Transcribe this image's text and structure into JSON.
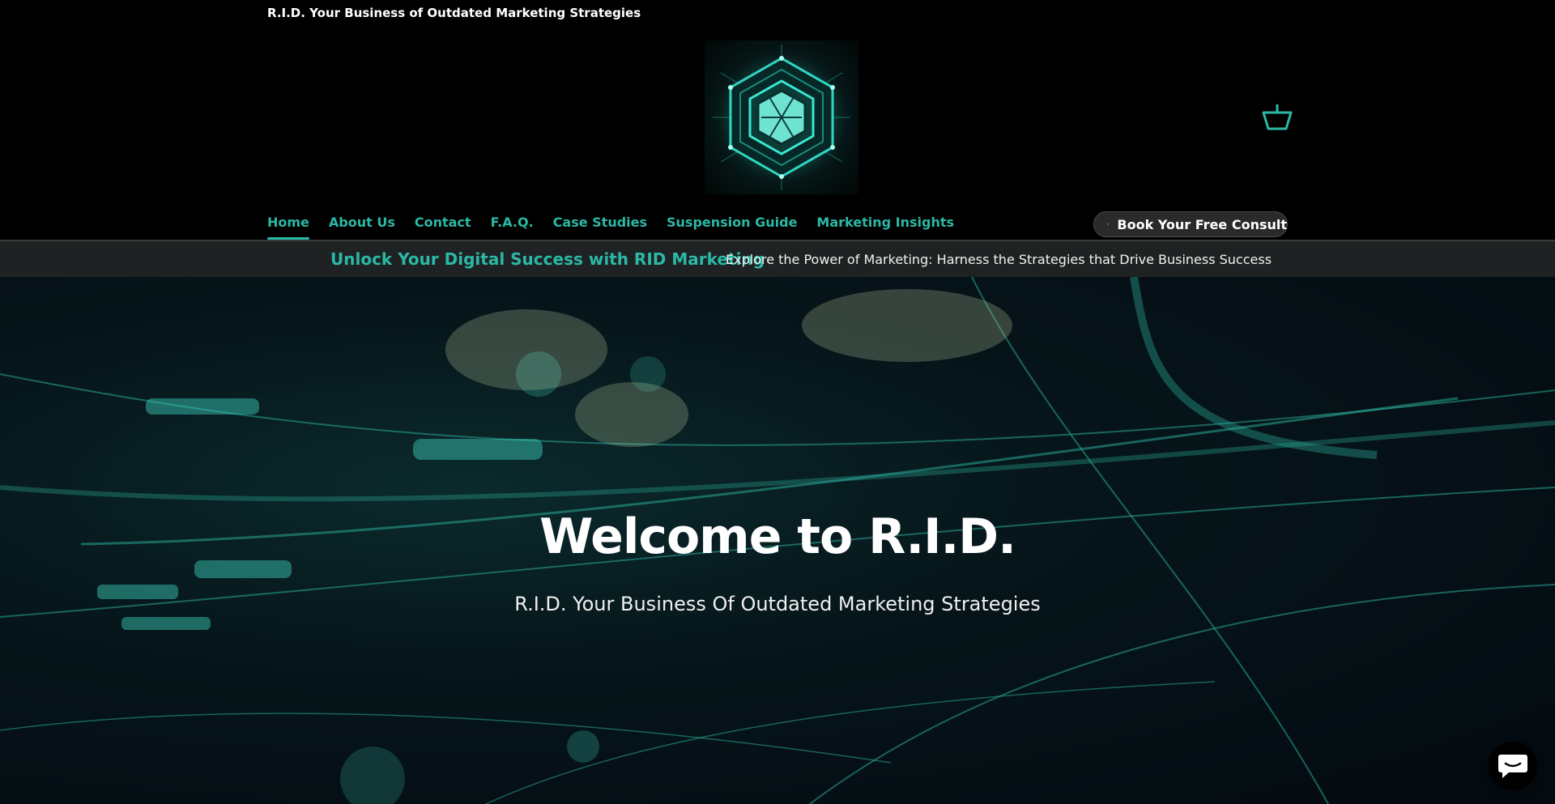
{
  "site": {
    "tagline": "R.I.D. Your Business of Outdated Marketing Strategies",
    "logo_icon": "hexagon-logo-icon",
    "cart_icon": "basket-icon"
  },
  "nav": {
    "items": [
      {
        "label": "Home",
        "active": true
      },
      {
        "label": "About Us"
      },
      {
        "label": "Contact"
      },
      {
        "label": "F.A.Q."
      },
      {
        "label": "Case Studies"
      },
      {
        "label": "Suspension Guide"
      },
      {
        "label": "Marketing Insights"
      }
    ],
    "consult_button": {
      "label": "Book Your Free Consult",
      "icon": "calendar-icon"
    }
  },
  "announcement": {
    "title": "Unlock Your Digital Success with RID Marketing",
    "text": "Explore the Power of Marketing: Harness the Strategies that Drive Business Success"
  },
  "hero": {
    "title": "Welcome to R.I.D.",
    "subtitle": "R.I.D. Your Business Of Outdated Marketing Strategies"
  },
  "chat": {
    "icon": "chat-bubble-icon"
  },
  "colors": {
    "accent": "#2bb8a6",
    "background": "#000000",
    "announcement_bg": "#1f2222"
  }
}
